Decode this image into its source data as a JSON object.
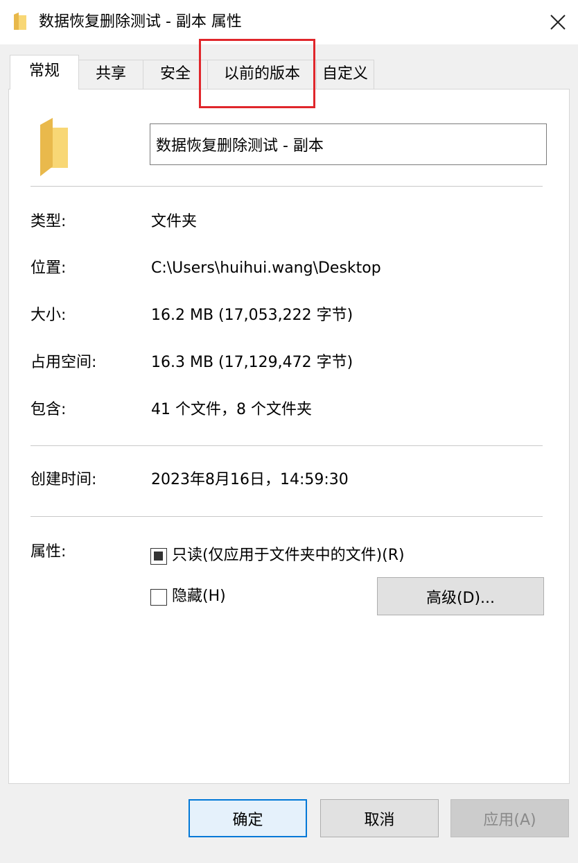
{
  "window": {
    "title": "数据恢复删除测试 - 副本 属性"
  },
  "tabs": [
    {
      "label": "常规",
      "active": true
    },
    {
      "label": "共享",
      "active": false
    },
    {
      "label": "安全",
      "active": false
    },
    {
      "label": "以前的版本",
      "active": false,
      "highlighted": true
    },
    {
      "label": "自定义",
      "active": false
    }
  ],
  "general": {
    "name": "数据恢复删除测试 - 副本",
    "rows": [
      {
        "label": "类型:",
        "value": "文件夹"
      },
      {
        "label": "位置:",
        "value": "C:\\Users\\huihui.wang\\Desktop"
      },
      {
        "label": "大小:",
        "value": "16.2 MB (17,053,222 字节)"
      },
      {
        "label": "占用空间:",
        "value": "16.3 MB (17,129,472 字节)"
      },
      {
        "label": "包含:",
        "value": "41 个文件，8 个文件夹"
      }
    ],
    "created": {
      "label": "创建时间:",
      "value": "2023年8月16日，14:59:30"
    },
    "attributes": {
      "label": "属性:",
      "readonly": "只读(仅应用于文件夹中的文件)(R)",
      "readonly_state": "indeterminate",
      "hidden": "隐藏(H)",
      "hidden_state": "unchecked",
      "advanced_button": "高级(D)..."
    }
  },
  "footer": {
    "ok": "确定",
    "cancel": "取消",
    "apply": "应用(A)"
  },
  "colors": {
    "highlight": "#e0262b",
    "folder": "#f8d775",
    "default_button_border": "#0078d7"
  }
}
